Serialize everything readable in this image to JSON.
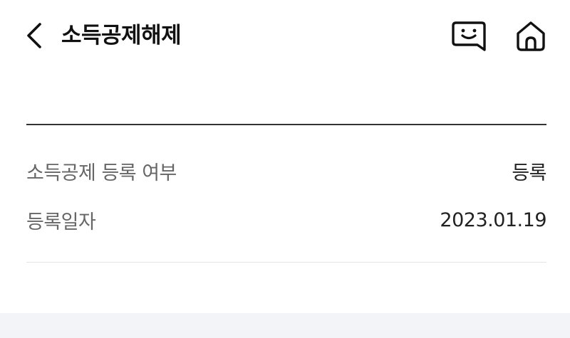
{
  "header": {
    "title": "소득공제해제",
    "back_icon": "chevron-left-icon",
    "chat_icon": "chat-bubble-smile-icon",
    "home_icon": "home-icon"
  },
  "details": {
    "rows": [
      {
        "label": "소득공제 등록 여부",
        "value": "등록"
      },
      {
        "label": "등록일자",
        "value": "2023.01.19"
      }
    ]
  },
  "colors": {
    "text_primary": "#111111",
    "text_secondary": "#666666",
    "divider_dark": "#333333",
    "divider_light": "#e4e4e4",
    "bottom_band": "#f2f4f8"
  }
}
